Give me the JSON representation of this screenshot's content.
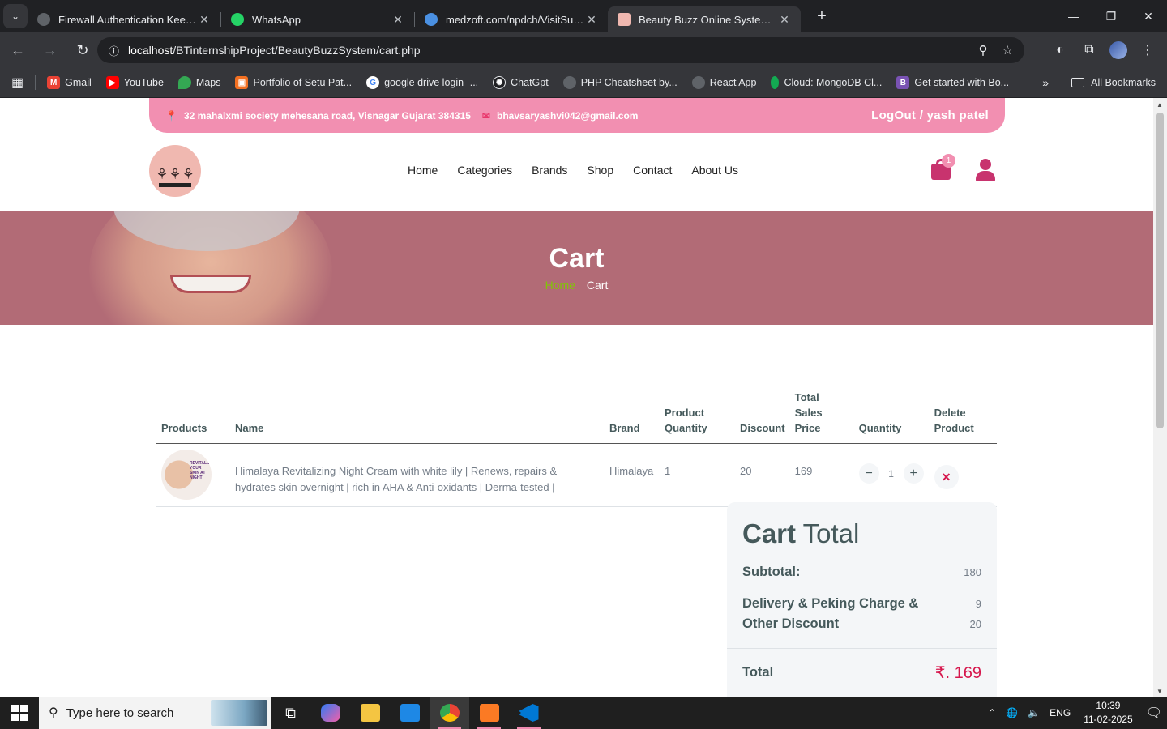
{
  "browser": {
    "tabs": [
      {
        "title": "Firewall Authentication Keepalive",
        "icon": "globe-icon",
        "active": false
      },
      {
        "title": "WhatsApp",
        "icon": "whatsapp-icon",
        "active": false
      },
      {
        "title": "medzoft.com/npdch/VisitSumm",
        "icon": "medzoft-icon",
        "active": false
      },
      {
        "title": "Beauty Buzz Online System - Ca",
        "icon": "beautybuzz-icon",
        "active": true
      }
    ],
    "url_host": "localhost",
    "url_path": "/BTinternshipProject/BeautyBuzzSystem/cart.php",
    "bookmarks": [
      {
        "label": "Gmail",
        "icon": "gmail-icon",
        "color": "#ea4335"
      },
      {
        "label": "YouTube",
        "icon": "youtube-icon",
        "color": "#ff0000"
      },
      {
        "label": "Maps",
        "icon": "maps-icon",
        "color": "#34a853"
      },
      {
        "label": "Portfolio of Setu Pat...",
        "icon": "portfolio-icon",
        "color": "#f37021"
      },
      {
        "label": "google drive login -...",
        "icon": "google-icon",
        "color": "#4285f4"
      },
      {
        "label": "ChatGpt",
        "icon": "chatgpt-icon",
        "color": "#202124"
      },
      {
        "label": "PHP Cheatsheet by...",
        "icon": "globe-icon",
        "color": "#5f6368"
      },
      {
        "label": "React App",
        "icon": "globe-icon",
        "color": "#5f6368"
      },
      {
        "label": "Cloud: MongoDB Cl...",
        "icon": "mongodb-icon",
        "color": "#13aa52"
      },
      {
        "label": "Get started with Bo...",
        "icon": "bootstrap-icon",
        "color": "#7952b3"
      }
    ],
    "all_bookmarks": "All Bookmarks"
  },
  "site": {
    "address": "32 mahalxmi society mehesana road, Visnagar Gujarat 384315",
    "email": "bhavsaryashvi042@gmail.com",
    "account": "LogOut / yash patel",
    "menu": [
      "Home",
      "Categories",
      "Brands",
      "Shop",
      "Contact",
      "About Us"
    ],
    "cart_count": "1",
    "hero_title": "Cart",
    "breadcrumb_home": "Home",
    "breadcrumb_current": "Cart"
  },
  "cart_table": {
    "headers": {
      "products": "Products",
      "name": "Name",
      "brand": "Brand",
      "product_quantity": "Product Quantity",
      "discount": "Discount",
      "total_sales_price": "Total Sales Price",
      "quantity": "Quantity",
      "delete_product": "Delete Product"
    },
    "rows": [
      {
        "image_text": "REVITALIZE YOUR SKIN AT NIGHT",
        "name": "Himalaya Revitalizing Night Cream with white lily | Renews, repairs & hydrates skin overnight | rich in AHA & Anti-oxidants | Derma-tested |",
        "brand": "Himalaya",
        "product_quantity": "1",
        "discount": "20",
        "total_sales_price": "169",
        "quantity": "1"
      }
    ]
  },
  "cart_total": {
    "title_bold": "Cart",
    "title_rest": " Total",
    "subtotal_label": "Subtotal:",
    "subtotal_value": "180",
    "delivery_label": "Delivery & Peking Charge & Other Discount",
    "delivery_value": "9",
    "discount_value": "20",
    "total_label": "Total",
    "total_value": "₹. 169"
  },
  "taskbar": {
    "search_placeholder": "Type here to search",
    "language": "ENG",
    "time": "10:39",
    "date": "11-02-2025"
  }
}
